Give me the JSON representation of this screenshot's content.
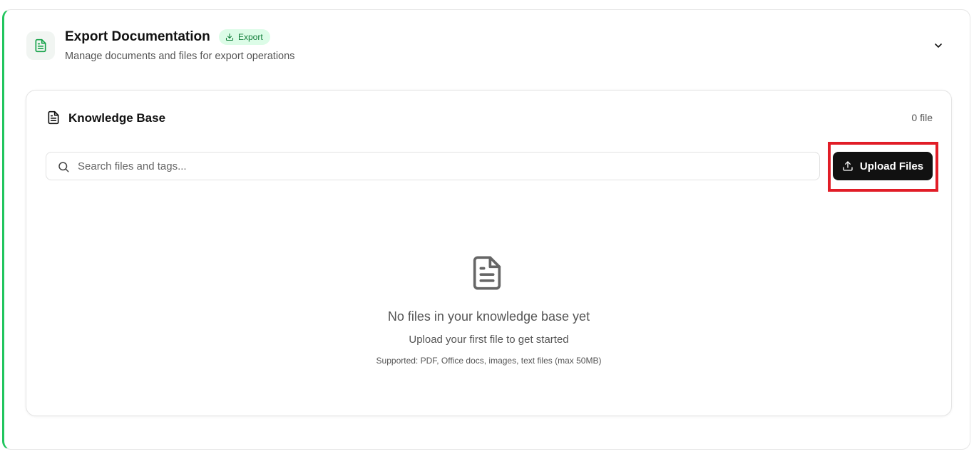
{
  "section": {
    "title": "Export Documentation",
    "badge": "Export",
    "subtitle": "Manage documents and files for export operations",
    "icon": "document-icon",
    "accent_color": "#22c55e",
    "badge_bg": "#dcfce7",
    "badge_color": "#15803d"
  },
  "knowledge_base": {
    "title": "Knowledge Base",
    "file_count": "0 file",
    "search": {
      "placeholder": "Search files and tags...",
      "value": ""
    },
    "upload_label": "Upload Files",
    "highlight_color": "#e11d27",
    "empty_state": {
      "title": "No files in your knowledge base yet",
      "subtitle": "Upload your first file to get started",
      "hint": "Supported: PDF, Office docs, images, text files (max 50MB)"
    }
  }
}
